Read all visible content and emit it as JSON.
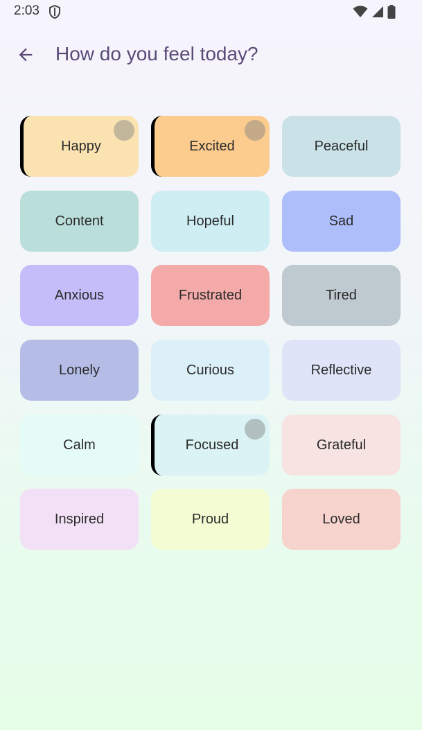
{
  "status_bar": {
    "time": "2:03"
  },
  "header": {
    "title": "How do you feel today?"
  },
  "moods": [
    {
      "label": "Happy",
      "color": "#fae3b1",
      "selected": true
    },
    {
      "label": "Excited",
      "color": "#fbcc8e",
      "selected": true
    },
    {
      "label": "Peaceful",
      "color": "#c9e1e7",
      "selected": false
    },
    {
      "label": "Content",
      "color": "#badeda",
      "selected": false
    },
    {
      "label": "Hopeful",
      "color": "#ceeef4",
      "selected": false
    },
    {
      "label": "Sad",
      "color": "#aebefa",
      "selected": false
    },
    {
      "label": "Anxious",
      "color": "#c5bdfa",
      "selected": false
    },
    {
      "label": "Frustrated",
      "color": "#f3aaa8",
      "selected": false
    },
    {
      "label": "Tired",
      "color": "#bfc9d0",
      "selected": false
    },
    {
      "label": "Lonely",
      "color": "#b5bde7",
      "selected": false
    },
    {
      "label": "Curious",
      "color": "#dbf0f8",
      "selected": false
    },
    {
      "label": "Reflective",
      "color": "#dfe4f8",
      "selected": false
    },
    {
      "label": "Calm",
      "color": "#e5fbf6",
      "selected": false
    },
    {
      "label": "Focused",
      "color": "#dbf3f4",
      "selected": true
    },
    {
      "label": "Grateful",
      "color": "#f6e3e2",
      "selected": false
    },
    {
      "label": "Inspired",
      "color": "#f2e0f6",
      "selected": false
    },
    {
      "label": "Proud",
      "color": "#f3fcd2",
      "selected": false
    },
    {
      "label": "Loved",
      "color": "#f6d3cc",
      "selected": false
    }
  ]
}
